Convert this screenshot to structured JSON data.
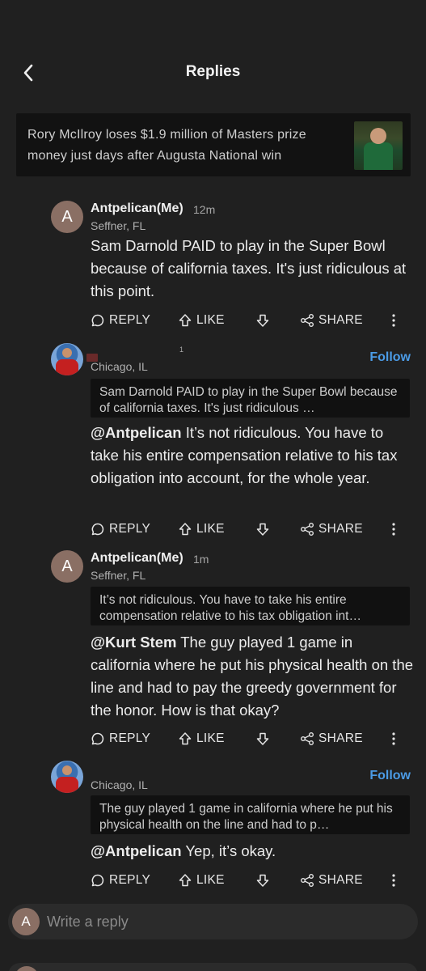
{
  "header": {
    "title": "Replies",
    "back_icon": "chevron-left-icon"
  },
  "article": {
    "title": "Rory McIlroy loses $1.9 million of Masters prize money just days after Augusta National win"
  },
  "actions": {
    "reply": "REPLY",
    "like": "LIKE",
    "share": "SHARE"
  },
  "comments": [
    {
      "avatar_letter": "A",
      "username": "Antpelican(Me)",
      "time": "12m",
      "location": "Seffner, FL",
      "text": "Sam Darnold PAID to play in the Super Bowl because of california taxes. It's just ridiculous at this point."
    },
    {
      "location": "Chicago, IL",
      "badge": "1",
      "follow": "Follow",
      "quote": "Sam Darnold PAID to play in the Super Bowl because of california taxes. It's just ridiculous …",
      "mention": "@Antpelican",
      "text": " It’s not ridiculous. You have to take his entire compensation relative to his tax obligation into account, for the whole year."
    },
    {
      "avatar_letter": "A",
      "username": "Antpelican(Me)",
      "time": "1m",
      "location": "Seffner, FL",
      "quote": "It’s not ridiculous. You have to take his entire compensation relative to his tax obligation int…",
      "mention": "@Kurt Stem",
      "text": " The guy played 1 game in california where he put his physical health on the line and had to pay the greedy government for the honor. How is that okay?"
    },
    {
      "location": "Chicago, IL",
      "follow": "Follow",
      "quote": "The guy played 1 game in california where he put his physical health on the line and had to p…",
      "mention": "@Antpelican",
      "text": " Yep, it’s okay."
    }
  ],
  "reply_bar": {
    "avatar_letter": "A",
    "placeholder": "Write a reply"
  },
  "colors": {
    "background": "#202020",
    "card": "#121212",
    "follow": "#4b9be6",
    "avatar": "#8a6f64"
  }
}
